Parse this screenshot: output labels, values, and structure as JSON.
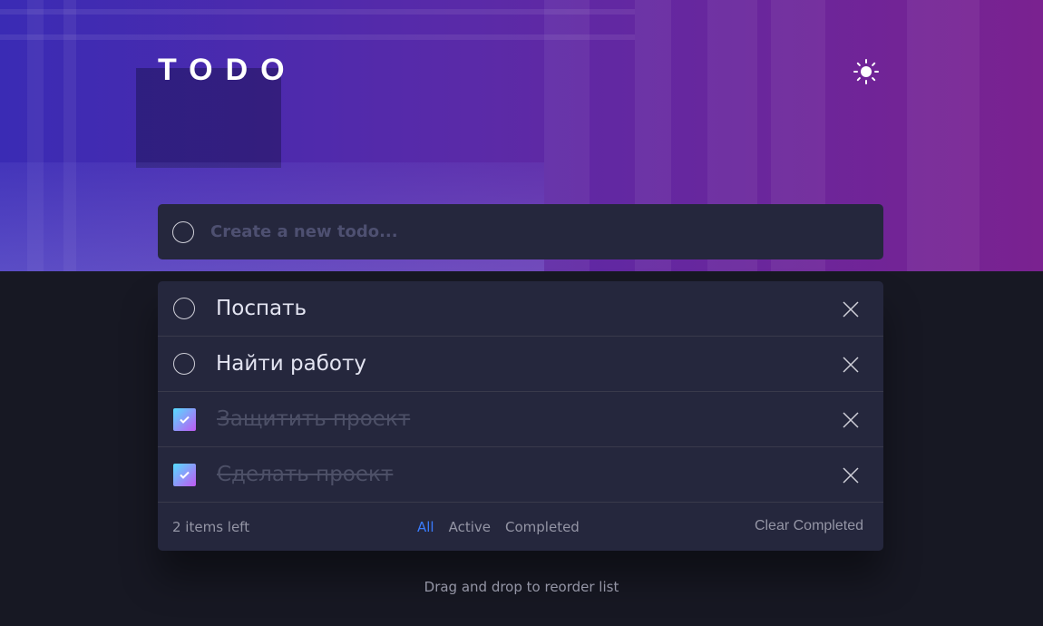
{
  "header": {
    "title": "TODO",
    "theme_icon": "sun-icon"
  },
  "new_todo": {
    "placeholder": "Create a new todo..."
  },
  "todos": [
    {
      "text": "Поспать",
      "completed": false
    },
    {
      "text": "Найти работу",
      "completed": false
    },
    {
      "text": "Защитить проект",
      "completed": true
    },
    {
      "text": "Сделать проект",
      "completed": true
    }
  ],
  "footer": {
    "items_left": "2 items left",
    "filters": [
      "All",
      "Active",
      "Completed"
    ],
    "active_filter": "All",
    "clear_label": "Clear Completed"
  },
  "hint": "Drag and drop to reorder list",
  "colors": {
    "accent": "#3a7cfd",
    "check_gradient_start": "#55ddff",
    "check_gradient_end": "#c058f3",
    "card_bg": "#25273d",
    "page_bg": "#171823"
  }
}
